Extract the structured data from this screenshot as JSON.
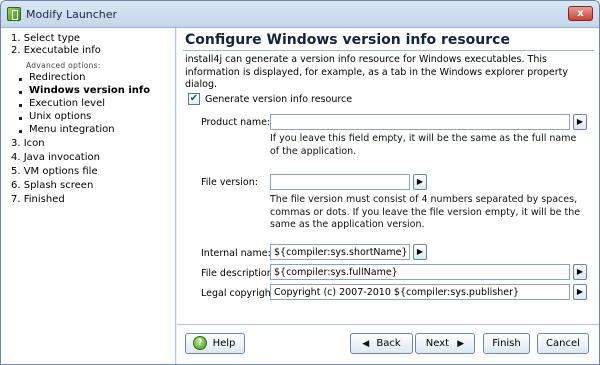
{
  "window": {
    "title": "Modify Launcher",
    "close_glyph": "x"
  },
  "sidebar": {
    "items": [
      {
        "label": "1. Select type"
      },
      {
        "label": "2. Executable info"
      },
      {
        "label": "3. Icon"
      },
      {
        "label": "4. Java invocation"
      },
      {
        "label": "5. VM options file"
      },
      {
        "label": "6. Splash screen"
      },
      {
        "label": "7. Finished"
      }
    ],
    "advanced_label": "Advanced options:",
    "sub_items": [
      {
        "label": "Redirection"
      },
      {
        "label": "Windows version info"
      },
      {
        "label": "Execution level"
      },
      {
        "label": "Unix options"
      },
      {
        "label": "Menu integration"
      }
    ]
  },
  "main": {
    "title": "Configure Windows version info resource",
    "description": "install4j can generate a version info resource for Windows executables. This information is displayed, for example, as a tab in the Windows explorer property dialog.",
    "generate_checkbox": {
      "label": "Generate version info resource",
      "checked": true,
      "glyph": "✔"
    },
    "product_name": {
      "label": "Product name:",
      "value": "",
      "hint": "If you leave this field empty, it will be the same as the full name of the application."
    },
    "file_version": {
      "label": "File version:",
      "value": "",
      "hint": "The file version must consist of 4 numbers separated by spaces, commas or dots. If you leave the file version empty, it will be the same as the application version."
    },
    "internal_name": {
      "label": "Internal name:",
      "value": "${compiler:sys.shortName}"
    },
    "file_description": {
      "label": "File description:",
      "value": "${compiler:sys.fullName}"
    },
    "legal_copyright": {
      "label": "Legal copyright:",
      "value": "Copyright (c) 2007-2010 ${compiler:sys.publisher}"
    },
    "arrow_glyph": "▶"
  },
  "footer": {
    "help": "Help",
    "help_glyph": "?",
    "back": "Back",
    "back_glyph": "◀",
    "next": "Next",
    "next_glyph": "▶",
    "finish": "Finish",
    "cancel": "Cancel"
  }
}
